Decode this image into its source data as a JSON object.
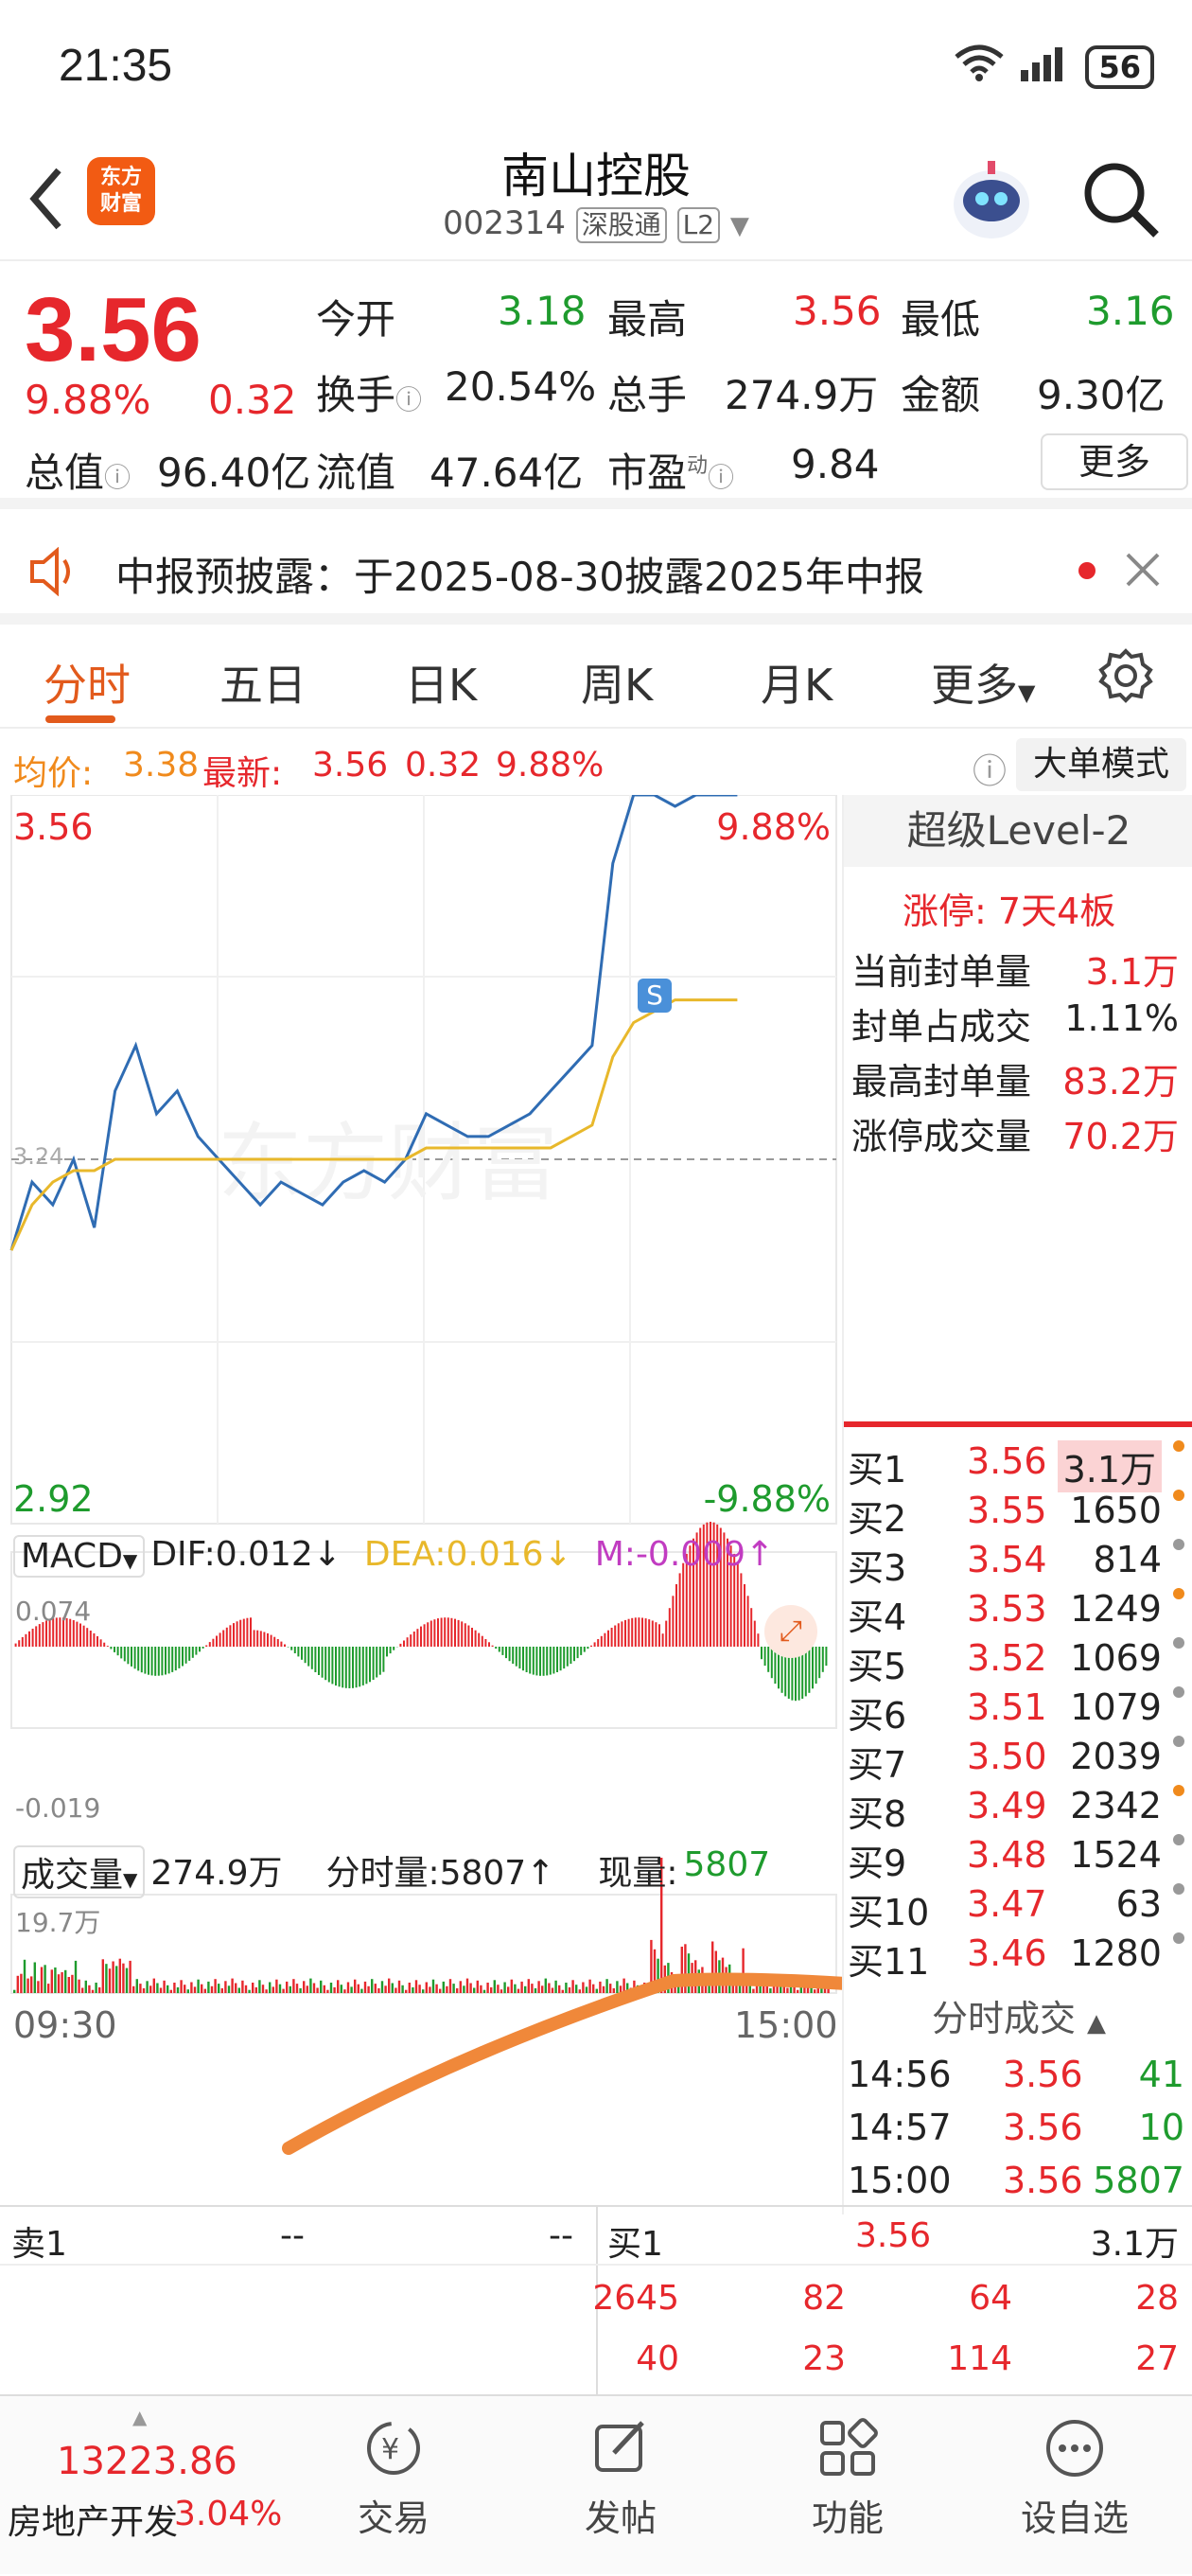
{
  "status": {
    "time": "21:35",
    "signal": "6",
    "battery": "56"
  },
  "header": {
    "title": "南山控股",
    "code": "002314",
    "tag1": "深股通",
    "tag2": "L2",
    "logo_line1": "东方",
    "logo_line2": "财富"
  },
  "quote": {
    "price": "3.56",
    "change_pct": "9.88%",
    "change": "0.32",
    "open_label": "今开",
    "open": "3.18",
    "high_label": "最高",
    "high": "3.56",
    "low_label": "最低",
    "low": "3.16",
    "turnover_label": "换手",
    "turnover": "20.54%",
    "volume_label": "总手",
    "volume": "274.9万",
    "amount_label": "金额",
    "amount": "9.30亿",
    "mktcap_label": "总值",
    "mktcap": "96.40亿",
    "float_label": "流值",
    "float": "47.64亿",
    "pe_label": "市盈",
    "pe_sup": "动",
    "pe": "9.84",
    "more": "更多"
  },
  "notice": {
    "text": "中报预披露：于2025-08-30披露2025年中报"
  },
  "tabs": [
    "分时",
    "五日",
    "日K",
    "周K",
    "月K",
    "更多"
  ],
  "infoline": {
    "avg_label": "均价:",
    "avg": "3.38",
    "latest_label": "最新:",
    "latest": "3.56",
    "chg": "0.32",
    "pct": "9.88%",
    "bigorder": "大单模式"
  },
  "chart": {
    "y_top": "3.56",
    "y_bottom": "2.92",
    "pct_top": "9.88%",
    "pct_bottom": "-9.88%",
    "mid_label": "3.24",
    "s_marker": "S",
    "macd_label": "MACD",
    "dif": "DIF:0.012↓",
    "dea": "DEA:0.016↓",
    "m": "M:-0.009↑",
    "macd_top": "0.074",
    "macd_bottom": "-0.019",
    "vol_label": "成交量",
    "vol_total": "274.9万",
    "vol_min": "分时量:5807↑",
    "vol_now_label": "现量:",
    "vol_now": "5807",
    "vol_top": "19.7万",
    "t_start": "09:30",
    "t_end": "15:00",
    "watermark": "东方财富"
  },
  "chart_data": {
    "type": "line",
    "x_range": [
      "09:30",
      "15:00"
    ],
    "ylim": [
      2.92,
      3.56
    ],
    "reference": 3.24,
    "series": [
      {
        "values": [
          3.16,
          3.22,
          3.2,
          3.24,
          3.18,
          3.3,
          3.34,
          3.28,
          3.3,
          3.26,
          3.24,
          3.22,
          3.2,
          3.22,
          3.21,
          3.2,
          3.22,
          3.23,
          3.22,
          3.24,
          3.28,
          3.27,
          3.26,
          3.26,
          3.27,
          3.28,
          3.3,
          3.32,
          3.34,
          3.5,
          3.56,
          3.56,
          3.55,
          3.56,
          3.56,
          3.56
        ]
      },
      {
        "values": [
          3.16,
          3.2,
          3.22,
          3.23,
          3.23,
          3.24,
          3.24,
          3.24,
          3.24,
          3.24,
          3.24,
          3.24,
          3.24,
          3.24,
          3.24,
          3.24,
          3.24,
          3.24,
          3.24,
          3.24,
          3.25,
          3.25,
          3.25,
          3.25,
          3.25,
          3.25,
          3.25,
          3.26,
          3.27,
          3.33,
          3.36,
          3.37,
          3.38,
          3.38,
          3.38,
          3.38
        ]
      }
    ]
  },
  "rpanel": {
    "title": "超级Level-2",
    "limit_label": "涨停:",
    "limit": "7天4板",
    "rows": [
      {
        "label": "当前封单量",
        "value": "3.1万"
      },
      {
        "label": "封单占成交",
        "value": "1.11%"
      },
      {
        "label": "最高封单量",
        "value": "83.2万"
      },
      {
        "label": "涨停成交量",
        "value": "70.2万"
      }
    ],
    "book": [
      {
        "label": "买1",
        "price": "3.56",
        "vol": "3.1万",
        "dot": "#f08a1c"
      },
      {
        "label": "买2",
        "price": "3.55",
        "vol": "1650",
        "dot": "#f08a1c"
      },
      {
        "label": "买3",
        "price": "3.54",
        "vol": "814",
        "dot": "#999999"
      },
      {
        "label": "买4",
        "price": "3.53",
        "vol": "1249",
        "dot": "#f08a1c"
      },
      {
        "label": "买5",
        "price": "3.52",
        "vol": "1069",
        "dot": "#999999"
      },
      {
        "label": "买6",
        "price": "3.51",
        "vol": "1079",
        "dot": "#999999"
      },
      {
        "label": "买7",
        "price": "3.50",
        "vol": "2039",
        "dot": "#999999"
      },
      {
        "label": "买8",
        "price": "3.49",
        "vol": "2342",
        "dot": "#f08a1c"
      },
      {
        "label": "买9",
        "price": "3.48",
        "vol": "1524",
        "dot": "#999999"
      },
      {
        "label": "买10",
        "price": "3.47",
        "vol": "63",
        "dot": "#999999"
      },
      {
        "label": "买11",
        "price": "3.46",
        "vol": "1280",
        "dot": "#999999"
      }
    ],
    "ticks_title": "分时成交",
    "ticks": [
      {
        "time": "14:56",
        "price": "3.56",
        "vol": "41"
      },
      {
        "time": "14:57",
        "price": "3.56",
        "vol": "10"
      },
      {
        "time": "15:00",
        "price": "3.56",
        "vol": "5807"
      }
    ]
  },
  "depth": {
    "sell_label": "卖1",
    "sell_price": "--",
    "sell_vol": "--",
    "buy_label": "买1",
    "buy_price": "3.56",
    "buy_vol": "3.1万",
    "row1": [
      "2645",
      "82",
      "64",
      "28"
    ],
    "row2": [
      "40",
      "23",
      "114",
      "27"
    ]
  },
  "bottomnav": {
    "index_value": "13223.86",
    "index_name": "房地产开发",
    "index_pct": "3.04%",
    "items": [
      "交易",
      "发帖",
      "功能",
      "设自选"
    ]
  }
}
